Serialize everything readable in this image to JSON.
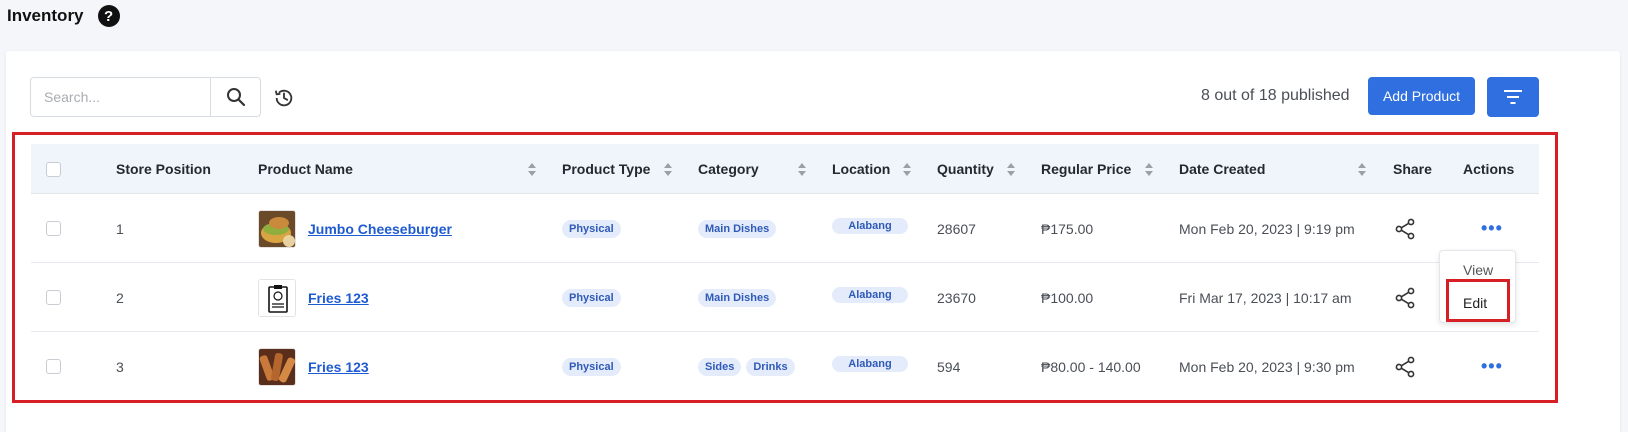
{
  "page": {
    "title": "Inventory",
    "help_glyph": "?"
  },
  "toolbar": {
    "search_placeholder": "Search...",
    "publish_count": "8 out of 18 published",
    "add_label": "Add Product"
  },
  "table": {
    "columns": {
      "store_position": "Store Position",
      "product_name": "Product Name",
      "product_type": "Product Type",
      "category": "Category",
      "location": "Location",
      "quantity": "Quantity",
      "regular_price": "Regular Price",
      "date_created": "Date Created",
      "share": "Share",
      "actions": "Actions"
    },
    "rows": [
      {
        "position": "1",
        "name": "Jumbo Cheeseburger",
        "type": "Physical",
        "categories": [
          "Main Dishes"
        ],
        "location": "Alabang",
        "quantity": "28607",
        "price": "₱175.00",
        "date": "Mon Feb 20, 2023 | 9:19 pm",
        "actions": "•••"
      },
      {
        "position": "2",
        "name": "Fries 123",
        "type": "Physical",
        "categories": [
          "Main Dishes"
        ],
        "location": "Alabang",
        "quantity": "23670",
        "price": "₱100.00",
        "date": "Fri Mar 17, 2023 | 10:17 am",
        "actions": ""
      },
      {
        "position": "3",
        "name": "Fries 123",
        "type": "Physical",
        "categories": [
          "Sides",
          "Drinks"
        ],
        "location": "Alabang",
        "quantity": "594",
        "price": "₱80.00 - 140.00",
        "date": "Mon Feb 20, 2023 | 9:30 pm",
        "actions": "•••"
      }
    ]
  },
  "action_menu": {
    "view": "View",
    "edit": "Edit"
  },
  "colors": {
    "accent": "#2f6fe0",
    "highlight": "#d71f26",
    "header_bg": "#f0f4fb",
    "tag_bg": "#e4ecfb"
  }
}
